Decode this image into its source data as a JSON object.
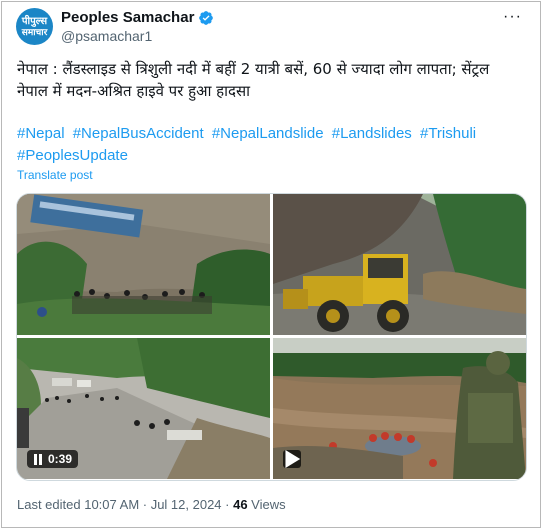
{
  "account": {
    "name": "Peoples Samachar",
    "handle": "@psamachar1",
    "avatar_line1": "पीपुल्स",
    "avatar_line2": "समाचार",
    "verified": true
  },
  "menu": {
    "more_label": "···"
  },
  "tweet": {
    "text": "नेपाल : लैंडस्लाइड से त्रिशुली नदी में बहीं 2 यात्री बसें, 60 से ज्यादा लोग लापता; सेंट्रल नेपाल में मदन-अश्रित हाइवे पर हुआ हादसा",
    "hashtags": [
      "#Nepal",
      "#NepalBusAccident",
      "#NepalLandslide",
      "#Landslides",
      "#Trishuli",
      "#PeoplesUpdate"
    ],
    "translate_label": "Translate post"
  },
  "media": {
    "video_duration": "0:39"
  },
  "footer": {
    "edited_label": "Last edited 10:07 AM · Jul 12, 2024 · ",
    "views_count": "46",
    "views_label": " Views"
  },
  "colors": {
    "link": "#1d9bf0",
    "verified": "#1d9bf0",
    "secondary_text": "#536471"
  }
}
